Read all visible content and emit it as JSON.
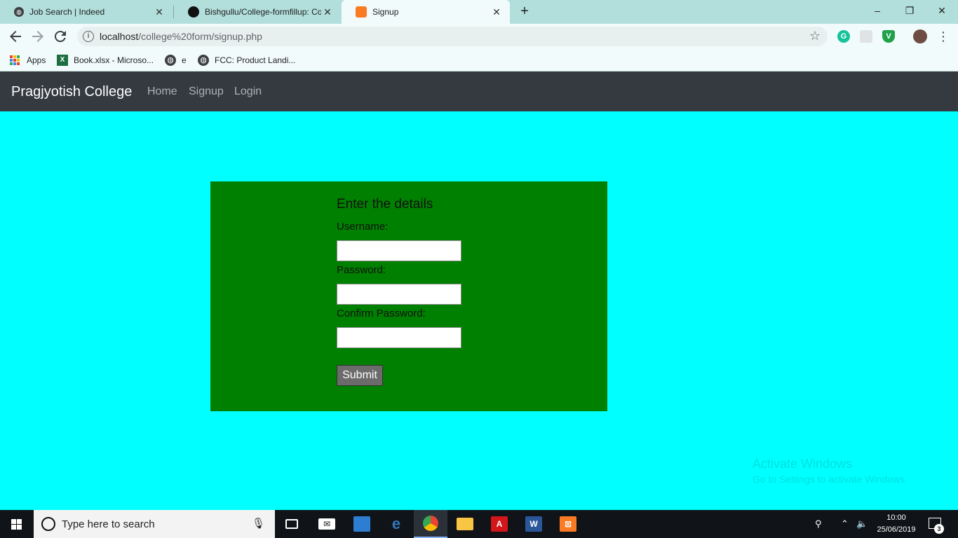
{
  "browser": {
    "tabs": [
      {
        "title": "Job Search | Indeed",
        "icon": "globe-icon"
      },
      {
        "title": "Bishgullu/College-formfillup: Col",
        "icon": "github-icon"
      },
      {
        "title": "Signup",
        "icon": "xampp-icon"
      }
    ],
    "close_glyph": "✕",
    "new_tab_glyph": "+",
    "window_controls": {
      "minimize": "–",
      "maximize": "❐",
      "close": "✕"
    },
    "url_host": "localhost",
    "url_path": "/college%20form/signup.php",
    "bookmarks": [
      {
        "label": "Apps",
        "icon": "apps-grid-icon"
      },
      {
        "label": "Book.xlsx - Microso...",
        "icon": "excel-icon"
      },
      {
        "label": "e",
        "icon": "globe-icon"
      },
      {
        "label": "FCC: Product Landi...",
        "icon": "globe-icon"
      }
    ]
  },
  "site": {
    "brand": "Pragjyotish College",
    "nav": [
      "Home",
      "Signup",
      "Login"
    ],
    "bg_color": "#00ffff",
    "navbar_color": "#343a40",
    "card_color": "#008000"
  },
  "form": {
    "title": "Enter the details",
    "username_label": "Username:",
    "password_label": "Password:",
    "confirm_label": "Confirm Password:",
    "username_value": "",
    "password_value": "",
    "confirm_value": "",
    "submit_label": "Submit"
  },
  "watermark": {
    "line1": "Activate Windows",
    "line2": "Go to Settings to activate Windows."
  },
  "taskbar": {
    "search_placeholder": "Type here to search",
    "time": "10:00",
    "date": "25/06/2019",
    "notification_count": "3",
    "apps": [
      "task-view-icon",
      "mail-icon",
      "app-icon",
      "edge-icon",
      "chrome-icon",
      "file-explorer-icon",
      "acrobat-icon",
      "word-icon",
      "xampp-icon"
    ]
  }
}
